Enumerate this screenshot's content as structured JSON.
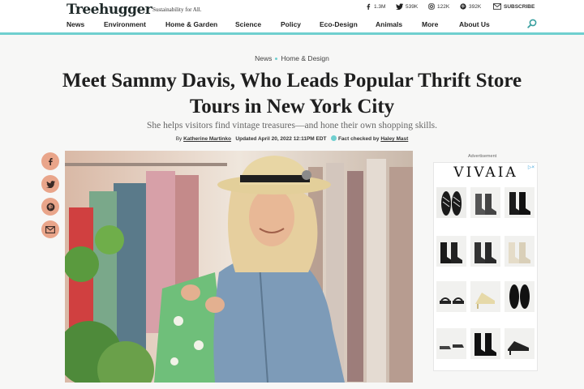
{
  "site": {
    "logo": "Treehugger",
    "tagline": "Sustainability for All."
  },
  "social": [
    {
      "icon": "facebook-icon",
      "count": "1.3M"
    },
    {
      "icon": "twitter-icon",
      "count": "539K"
    },
    {
      "icon": "instagram-icon",
      "count": "122K"
    },
    {
      "icon": "pinterest-icon",
      "count": "392K"
    }
  ],
  "subscribe_label": "SUBSCRIBE",
  "nav": [
    "News",
    "Environment",
    "Home & Garden",
    "Science",
    "Policy",
    "Eco-Design",
    "Animals",
    "More",
    "About Us"
  ],
  "breadcrumb": [
    "News",
    "Home & Design"
  ],
  "article": {
    "headline_line1": "Meet Sammy Davis, Who Leads Popular Thrift Store",
    "headline_line2": "Tours in New York City",
    "subhead": "She helps visitors find vintage treasures—and hone their own shopping skills.",
    "by_prefix": "By",
    "author": "Katherine Martinko",
    "updated": "Updated April 20, 2022 12:11PM EDT",
    "fact_checked_prefix": "Fact checked by",
    "fact_checker": "Haley Mast"
  },
  "share_buttons": [
    "facebook-share-icon",
    "twitter-share-icon",
    "pinterest-share-icon",
    "email-share-icon"
  ],
  "ad": {
    "label": "Advertisement",
    "brand": "VIVAIA",
    "close_glyph": "▷×"
  },
  "colors": {
    "accent_teal": "#6fcfcf",
    "share_salmon": "#e9a58a"
  }
}
